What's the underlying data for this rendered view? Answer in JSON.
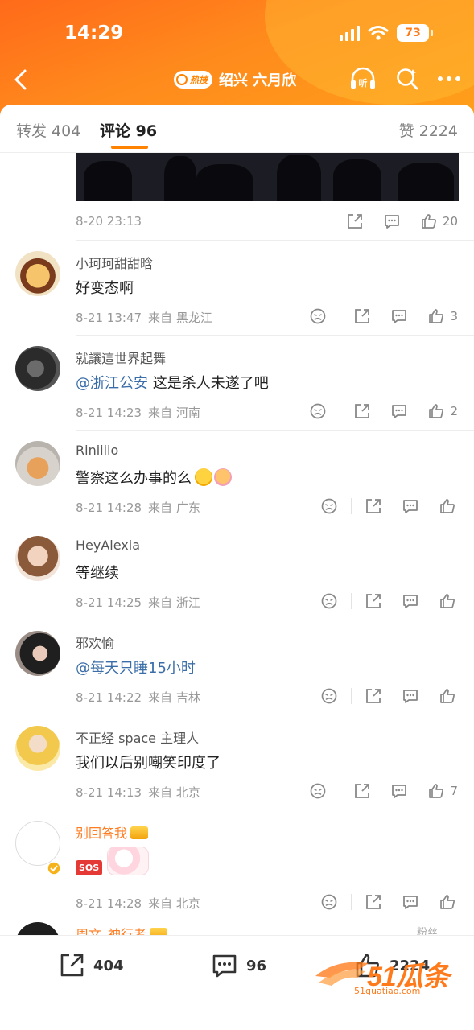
{
  "status": {
    "time": "14:29",
    "battery": "73"
  },
  "nav": {
    "hot_label": "热搜",
    "title": "绍兴 六月欣"
  },
  "tabs": {
    "repost": "转发 404",
    "comments": "评论 96",
    "likes": "赞 2224"
  },
  "top_post": {
    "time": "8-20 23:13",
    "like_count": "20"
  },
  "comments": [
    {
      "name": "小珂珂甜甜晗",
      "text": "好变态啊",
      "time": "8-21 13:47",
      "from": "来自 黑龙江",
      "likes": "3"
    },
    {
      "name": "就讓這世界起舞",
      "mention": "@浙江公安",
      "text": " 这是杀人未遂了吧",
      "time": "8-21 14:23",
      "from": "来自 河南",
      "likes": "2"
    },
    {
      "name": "Riniiiio",
      "text": "警察这么办事的么",
      "time": "8-21 14:28",
      "from": "来自 广东",
      "likes": ""
    },
    {
      "name": "HeyAlexia",
      "text": "等继续",
      "time": "8-21 14:25",
      "from": "来自 浙江",
      "likes": ""
    },
    {
      "name": "邪欢愉",
      "mention": "@每天只睡15小时",
      "text": "",
      "time": "8-21 14:22",
      "from": "来自 吉林",
      "likes": ""
    },
    {
      "name": "不正经 space 主理人",
      "text": "我们以后别嘲笑印度了",
      "time": "8-21 14:13",
      "from": "来自 北京",
      "likes": "7"
    },
    {
      "name": "别回答我",
      "sticker": "SOS",
      "time": "8-21 14:28",
      "from": "来自 北京",
      "likes": ""
    },
    {
      "name": "周文_神行者",
      "tag": "粉丝"
    }
  ],
  "bottom": {
    "repost": "404",
    "comments": "96",
    "likes": "2224"
  },
  "watermark": {
    "brand": "51瓜条",
    "url": "51guatiao.com"
  },
  "colors": {
    "accent": "#ff8200",
    "mention": "#3b6ea8"
  }
}
